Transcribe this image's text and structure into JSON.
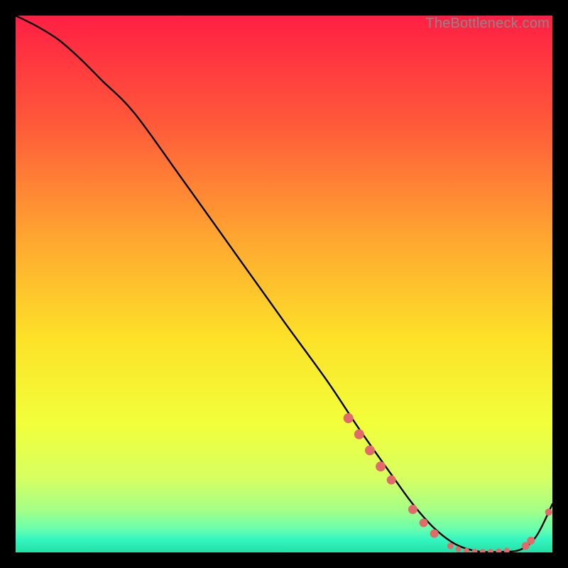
{
  "watermark": "TheBottleneck.com",
  "chart_data": {
    "type": "line",
    "title": "",
    "xlabel": "",
    "ylabel": "",
    "xlim": [
      0,
      100
    ],
    "ylim": [
      0,
      100
    ],
    "background_gradient": {
      "stops": [
        {
          "offset": 0.0,
          "color": "#ff1f44"
        },
        {
          "offset": 0.2,
          "color": "#ff593a"
        },
        {
          "offset": 0.42,
          "color": "#ffa830"
        },
        {
          "offset": 0.6,
          "color": "#fde128"
        },
        {
          "offset": 0.76,
          "color": "#f2ff3a"
        },
        {
          "offset": 0.86,
          "color": "#d7ff60"
        },
        {
          "offset": 0.92,
          "color": "#a6ff86"
        },
        {
          "offset": 0.955,
          "color": "#6cffab"
        },
        {
          "offset": 0.975,
          "color": "#36f7c0"
        },
        {
          "offset": 1.0,
          "color": "#22e0a6"
        }
      ]
    },
    "series": [
      {
        "name": "bottleneck-curve",
        "x": [
          0,
          4,
          8,
          12,
          16,
          22,
          30,
          40,
          50,
          58,
          64,
          70,
          74,
          78,
          82,
          86,
          90,
          94,
          97,
          100
        ],
        "y": [
          100,
          98,
          95.5,
          92,
          88,
          82,
          71,
          57,
          43,
          32,
          23,
          14.5,
          9,
          4.5,
          1.5,
          0.2,
          0.1,
          0.5,
          3,
          9
        ]
      }
    ],
    "markers": {
      "name": "highlight-dots",
      "color": "#E16A6A",
      "points": [
        {
          "x": 62,
          "y": 25,
          "r": 7
        },
        {
          "x": 64,
          "y": 22,
          "r": 7
        },
        {
          "x": 66,
          "y": 19,
          "r": 7
        },
        {
          "x": 68,
          "y": 16,
          "r": 7
        },
        {
          "x": 70,
          "y": 13.5,
          "r": 6.5
        },
        {
          "x": 74,
          "y": 8,
          "r": 6.5
        },
        {
          "x": 76,
          "y": 5.5,
          "r": 6
        },
        {
          "x": 78,
          "y": 3.5,
          "r": 6
        },
        {
          "x": 81,
          "y": 1.2,
          "r": 4.5
        },
        {
          "x": 82.5,
          "y": 0.6,
          "r": 4
        },
        {
          "x": 84,
          "y": 0.3,
          "r": 4
        },
        {
          "x": 85.5,
          "y": 0.15,
          "r": 4
        },
        {
          "x": 87,
          "y": 0.1,
          "r": 4
        },
        {
          "x": 88.5,
          "y": 0.12,
          "r": 4
        },
        {
          "x": 90,
          "y": 0.2,
          "r": 4
        },
        {
          "x": 91.5,
          "y": 0.35,
          "r": 4
        },
        {
          "x": 95,
          "y": 1.2,
          "r": 5.5
        },
        {
          "x": 96,
          "y": 2.2,
          "r": 5.5
        },
        {
          "x": 99.3,
          "y": 7.5,
          "r": 5
        }
      ]
    }
  }
}
